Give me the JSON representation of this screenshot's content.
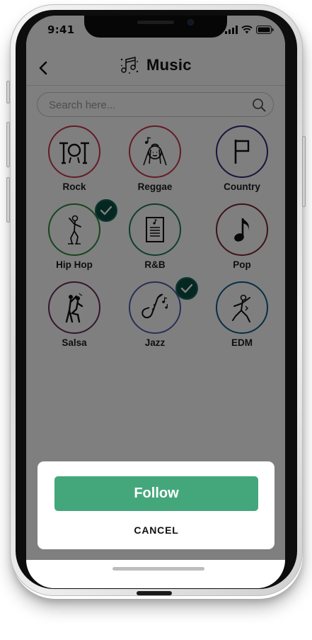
{
  "status_bar": {
    "time": "9:41"
  },
  "header": {
    "title": "Music"
  },
  "search": {
    "placeholder": "Search here..."
  },
  "genres": [
    {
      "label": "Rock",
      "icon": "drum-kit-icon",
      "ring": "#c9364a",
      "selected": false
    },
    {
      "label": "Reggae",
      "icon": "reggae-singer-icon",
      "ring": "#c9364a",
      "selected": false
    },
    {
      "label": "Country",
      "icon": "flag-icon",
      "ring": "#2e2a7a",
      "selected": false
    },
    {
      "label": "Hip Hop",
      "icon": "hip-hop-dancer-icon",
      "ring": "#2f8a3a",
      "selected": true
    },
    {
      "label": "R&B",
      "icon": "sheet-music-icon",
      "ring": "#1f7a62",
      "selected": false
    },
    {
      "label": "Pop",
      "icon": "music-note-icon",
      "ring": "#7a2632",
      "selected": false
    },
    {
      "label": "Salsa",
      "icon": "salsa-dancers-icon",
      "ring": "#6b2d5c",
      "selected": false
    },
    {
      "label": "Jazz",
      "icon": "saxophone-icon",
      "ring": "#4f5fb0",
      "selected": true
    },
    {
      "label": "EDM",
      "icon": "edm-dancer-icon",
      "ring": "#0f5d8c",
      "selected": false
    }
  ],
  "sheet": {
    "follow_label": "Follow",
    "cancel_label": "CANCEL"
  },
  "colors": {
    "primary": "#44a77c",
    "check_badge": "#0b4f45",
    "overlay": "rgba(0,0,0,0.5)"
  }
}
